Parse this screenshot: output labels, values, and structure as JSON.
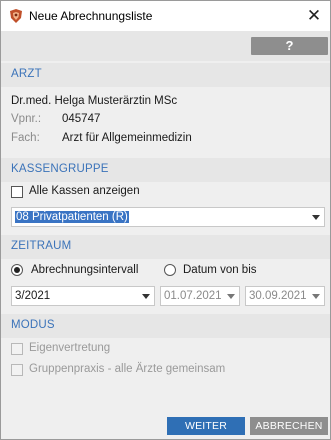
{
  "window": {
    "title": "Neue Abrechnungsliste",
    "close_symbol": "✕"
  },
  "toolbar": {
    "help_label": "?"
  },
  "arzt": {
    "header": "ARZT",
    "name": "Dr.med. Helga Musterärztin MSc",
    "vpnr_label": "Vpnr.:",
    "vpnr_value": "045747",
    "fach_label": "Fach:",
    "fach_value": "Arzt für Allgemeinmedizin"
  },
  "kassengruppe": {
    "header": "KASSENGRUPPE",
    "alle_kassen_label": "Alle Kassen anzeigen",
    "alle_kassen_checked": false,
    "selected": "08 Privatpatienten (R)"
  },
  "zeitraum": {
    "header": "ZEITRAUM",
    "option_intervall": "Abrechnungsintervall",
    "option_datum": "Datum von bis",
    "selected_option": "Abrechnungsintervall",
    "intervall_value": "3/2021",
    "date_from": "01.07.2021",
    "date_to": "30.09.2021"
  },
  "modus": {
    "header": "MODUS",
    "eigenvertretung_label": "Eigenvertretung",
    "gruppenpraxis_label": "Gruppenpraxis - alle Ärzte gemeinsam"
  },
  "footer": {
    "weiter_label": "WEITER",
    "abbrechen_label": "ABBRECHEN"
  },
  "colors": {
    "accent": "#3b73b9",
    "primary_button": "#2f6fb5",
    "secondary_button": "#8e8e8e",
    "app_icon": "#c0502a"
  }
}
